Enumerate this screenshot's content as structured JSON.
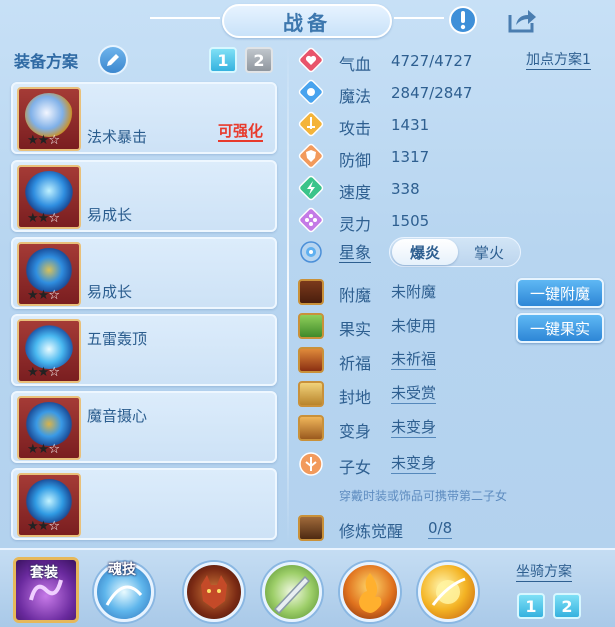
{
  "header": {
    "title": "战备",
    "info_icon": "exclamation-icon",
    "share_icon": "share-icon"
  },
  "equip_plan": {
    "title": "装备方案",
    "plan_buttons": [
      "1",
      "2"
    ],
    "active_plan": "1",
    "slots": [
      {
        "name": "法术暴击",
        "tag": "可强化",
        "stars_filled": 2,
        "stars_total": 3
      },
      {
        "name": "易成长",
        "tag": "",
        "stars_filled": 2,
        "stars_total": 3
      },
      {
        "name": "易成长",
        "tag": "",
        "stars_filled": 2,
        "stars_total": 3
      },
      {
        "name": "五雷轰顶",
        "tag": "",
        "stars_filled": 2,
        "stars_total": 3
      },
      {
        "name": "魔音摄心",
        "tag": "",
        "stars_filled": 2,
        "stars_total": 3
      },
      {
        "name": "",
        "tag": "",
        "stars_filled": 2,
        "stars_total": 3
      }
    ]
  },
  "stats": {
    "plan_link": "加点方案1",
    "items": [
      {
        "label": "气血",
        "value": "4727/4727",
        "icon": "heart-icon",
        "color": "#e8546b"
      },
      {
        "label": "魔法",
        "value": "2847/2847",
        "icon": "mana-icon",
        "color": "#48a3ee"
      },
      {
        "label": "攻击",
        "value": "1431",
        "icon": "sword-icon",
        "color": "#f4b43a"
      },
      {
        "label": "防御",
        "value": "1317",
        "icon": "shield-icon",
        "color": "#f29a5c"
      },
      {
        "label": "速度",
        "value": "338",
        "icon": "lightning-icon",
        "color": "#3ac48a"
      },
      {
        "label": "灵力",
        "value": "1505",
        "icon": "spirit-icon",
        "color": "#c47ae6"
      }
    ]
  },
  "constellation": {
    "label": "星象",
    "options": [
      "爆炎",
      "掌火"
    ],
    "selected": "爆炎"
  },
  "enhance": {
    "items": [
      {
        "label": "附魔",
        "value": "未附魔",
        "icon": "enchant-icon"
      },
      {
        "label": "果实",
        "value": "未使用",
        "icon": "fruit-icon"
      },
      {
        "label": "祈福",
        "value": "未祈福",
        "icon": "blessing-icon"
      },
      {
        "label": "封地",
        "value": "未受赏",
        "icon": "fief-icon"
      },
      {
        "label": "变身",
        "value": "未变身",
        "icon": "transform-icon"
      },
      {
        "label": "子女",
        "value": "未变身",
        "icon": "child-icon"
      }
    ],
    "buttons": [
      "一键附魔",
      "一键果实"
    ],
    "note": "穿戴时装或饰品可携带第二子女",
    "cultivation": {
      "label": "修炼觉醒",
      "value": "0/8",
      "icon": "cultivation-icon"
    }
  },
  "bottom": {
    "tabs": [
      "套装",
      "魂技"
    ],
    "skill_icons": [
      "wolf-skill-icon",
      "blade-skill-icon",
      "fire-skill-icon",
      "flame-orb-skill-icon"
    ],
    "mount_plan": {
      "title": "坐骑方案",
      "buttons": [
        "1",
        "2"
      ],
      "active": "2"
    }
  }
}
